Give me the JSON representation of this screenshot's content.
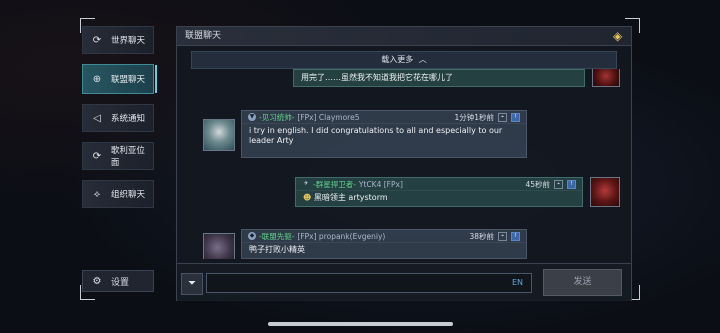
{
  "sidebar": {
    "items": [
      {
        "label": "世界聊天",
        "icon": "refresh-icon"
      },
      {
        "label": "联盟聊天",
        "icon": "globe-icon"
      },
      {
        "label": "系统通知",
        "icon": "speaker-icon"
      },
      {
        "label": "歌利亚位面",
        "icon": "refresh-icon"
      },
      {
        "label": "组织聊天",
        "icon": "handshake-icon"
      }
    ],
    "active_index": 1,
    "settings_label": "设置"
  },
  "panel": {
    "title": "联盟聊天",
    "load_more": "载入更多"
  },
  "messages": [
    {
      "text": "用完了……虽然我不知道我把它花在哪儿了",
      "self": true
    },
    {
      "title": "-见习统帅-",
      "name": "[FPx] Claymore5",
      "time": "1分钟1秒前",
      "text": "i try in english. I did congratulations to all and especially to our leader Arty"
    },
    {
      "title": "-群星捍卫者-",
      "name": "YtCK4 [FPx]",
      "time": "45秒前",
      "text": "黑暗领主 artystorm"
    },
    {
      "title": "-联盟先驱-",
      "name": "[FPx] propank(Evgeniy)",
      "time": "38秒前",
      "text": "鸭子打败小精英"
    }
  ],
  "input": {
    "lang": "EN",
    "send_label": "发送"
  },
  "colors": {
    "accent": "#5fd0dc",
    "title_green": "#5fd08a"
  }
}
